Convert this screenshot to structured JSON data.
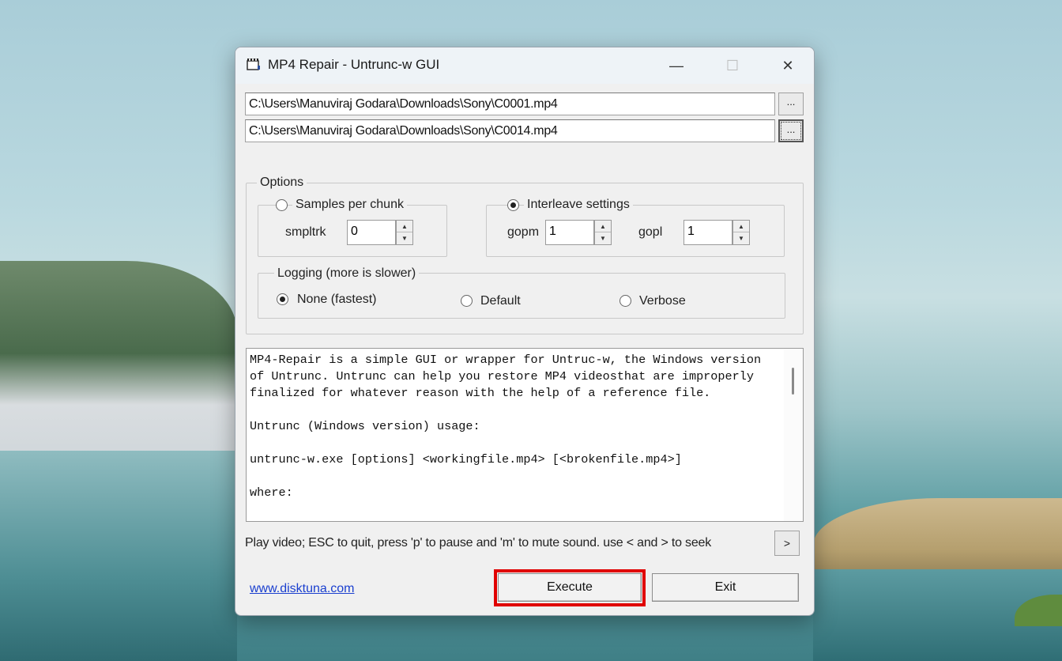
{
  "window": {
    "title": "MP4 Repair - Untrunc-w GUI",
    "minimize_glyph": "—",
    "maximize_glyph": "☐",
    "close_glyph": "✕"
  },
  "files": {
    "working_file": "C:\\Users\\Manuviraj Godara\\Downloads\\Sony\\C0001.mp4",
    "broken_file": "C:\\Users\\Manuviraj Godara\\Downloads\\Sony\\C0014.mp4",
    "browse_label": "...",
    "browse2_label": "..."
  },
  "options": {
    "legend": "Options",
    "samples_per_chunk": {
      "label": "Samples per chunk",
      "checked": false,
      "smpltrk_label": "smpltrk",
      "smpltrk_value": "0"
    },
    "interleave": {
      "label": "Interleave settings",
      "checked": true,
      "gopm_label": "gopm",
      "gopm_value": "1",
      "gopl_label": "gopl",
      "gopl_value": "1"
    },
    "logging": {
      "legend": "Logging  (more is slower)",
      "none_label": "None (fastest)",
      "default_label": "Default",
      "verbose_label": "Verbose",
      "selected": "None (fastest)"
    }
  },
  "description": "MP4-Repair is a simple GUI or wrapper for Untruc-w, the Windows version of Untrunc. Untrunc can help you restore MP4 videosthat are improperly finalized for whatever reason with the help of a reference file.\n\nUntrunc (Windows version) usage:\n\nuntrunc-w.exe [options] <workingfile.mp4> [<brokenfile.mp4>]\n\nwhere:",
  "status": {
    "play_hint": "Play video; ESC to quit, press 'p' to pause and 'm' to mute sound. use < and > to seek",
    "play_button": ">"
  },
  "footer": {
    "link": "www.disktuna.com",
    "execute": "Execute",
    "exit": "Exit"
  },
  "colors": {
    "highlight": "#e00000",
    "link": "#1a3fcf"
  }
}
